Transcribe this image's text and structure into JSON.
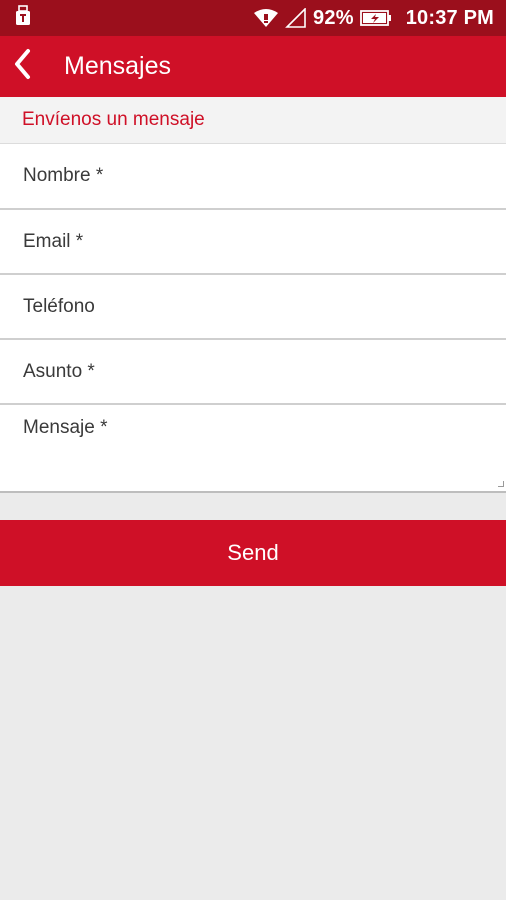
{
  "status_bar": {
    "battery_percent": "92%",
    "time": "10:37 PM",
    "icons": [
      "usb-icon",
      "wifi-icon",
      "signal-icon",
      "battery-charging-icon"
    ]
  },
  "app_bar": {
    "title": "Mensajes",
    "back_icon": "chevron-left-icon"
  },
  "section": {
    "title": "Envíenos un mensaje"
  },
  "form": {
    "name_placeholder": "Nombre *",
    "email_placeholder": "Email *",
    "phone_placeholder": "Teléfono",
    "subject_placeholder": "Asunto *",
    "message_placeholder": "Mensaje *",
    "name_value": "",
    "email_value": "",
    "phone_value": "",
    "subject_value": "",
    "message_value": ""
  },
  "actions": {
    "send_label": "Send"
  },
  "colors": {
    "status_bar": "#9b0f1c",
    "primary": "#cf1027",
    "section_bg": "#f3f3f3",
    "page_bg": "#ebebeb"
  }
}
